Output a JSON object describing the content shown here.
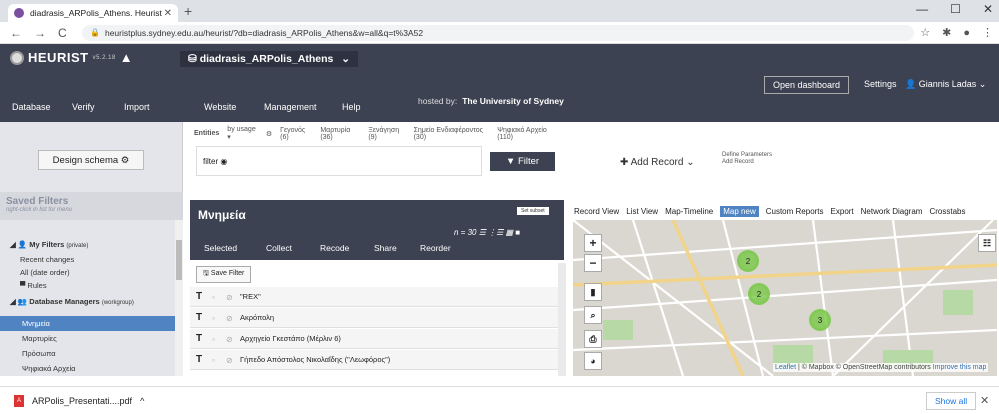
{
  "browser": {
    "tab_title": "diadrasis_ARPolis_Athens. Heurist",
    "url": "heuristplus.sydney.edu.au/heurist/?db=diadrasis_ARPolis_Athens&w=all&q=t%3A52"
  },
  "header": {
    "logo": "HEURIST",
    "version": "v5.2.18",
    "db": "diadrasis_ARPolis_Athens",
    "menu": [
      "Database",
      "Verify",
      "Import",
      "Website",
      "Management",
      "Help"
    ],
    "hosted_by": "hosted by:",
    "host": "The University of Sydney",
    "open_dashboard": "Open dashboard",
    "settings": "Settings",
    "user": "Giannis Ladas"
  },
  "left": {
    "design_schema": "Design schema",
    "saved_filters": "Saved Filters",
    "hint": "right-click in list for menu",
    "my_filters": "My Filters",
    "my_filters_tag": "(private)",
    "recent": "Recent changes",
    "all": "All (date order)",
    "rules": "Rules",
    "managers": "Database Managers",
    "managers_tag": "(workgroup)",
    "items": [
      "Μνημεία",
      "Μαρτυρίες",
      "Πρόσωπα",
      "Ψηφιακά Αρχεία"
    ]
  },
  "search": {
    "entities": "Entities",
    "by_usage": "by usage",
    "entity_tabs": [
      "Γεγονός (6)",
      "Μαρτυρία (36)",
      "Ξενάγηση (9)",
      "Σημείο Ενδιαφέροντος (30)",
      "Ψηφιακό Αρχείο (110)"
    ],
    "filter_placeholder": "filter",
    "filter_button": "Filter",
    "add_record": "Add Record",
    "define1": "Define Parameters",
    "define2": "Add Record"
  },
  "results": {
    "title": "Μνημεία",
    "edit_subset": "Set subset",
    "count": "n = 30",
    "actions": [
      "Selected",
      "Collect",
      "Recode",
      "Share",
      "Reorder"
    ],
    "save_filter": "Save Filter",
    "records": [
      "\"REX\"",
      "Ακρόπολη",
      "Αρχηγείο Γκεστάπο (Μέρλιν 6)",
      "Γήπεδο Απόστολος Νικολαΐδης (\"Λεωφόρος\")"
    ]
  },
  "tabs": [
    "Record View",
    "List View",
    "Map-Timeline",
    "Map new",
    "Custom Reports",
    "Export",
    "Network Diagram",
    "Crosstabs"
  ],
  "map": {
    "clusters": [
      "2",
      "2",
      "3"
    ],
    "attribution_a": "Leaflet",
    "attribution_b": "| © Mapbox © OpenStreetMap contributors",
    "improve": "Improve this map"
  },
  "download": {
    "file": "ARPolis_Presentati....pdf",
    "show_all": "Show all"
  }
}
